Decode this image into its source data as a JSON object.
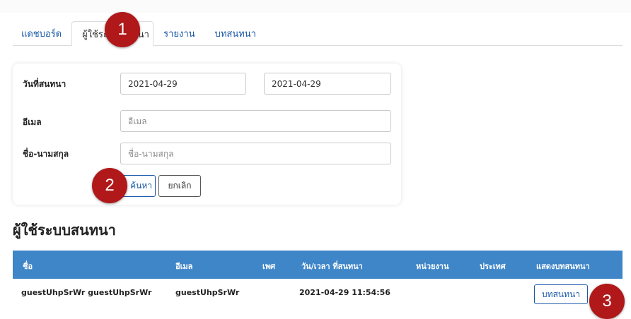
{
  "tabs": [
    {
      "label": "แดชบอร์ด"
    },
    {
      "label": "ผู้ใช้ระบบสนทนา"
    },
    {
      "label": "รายงาน"
    },
    {
      "label": "บทสนทนา"
    }
  ],
  "filter": {
    "date_label": "วันที่สนทนา",
    "date_from": "2021-04-29",
    "date_to": "2021-04-29",
    "email_label": "อีเมล",
    "email_placeholder": "อีเมล",
    "name_label": "ชื่อ-นามสกุล",
    "name_placeholder": "ชื่อ-นามสกุล",
    "search_label": "ค้นหา",
    "cancel_label": "ยกเลิก"
  },
  "section_title": "ผู้ใช้ระบบสนทนา",
  "table": {
    "headers": [
      "ชื่อ",
      "อีเมล",
      "เพศ",
      "วัน/เวลา ที่สนทนา",
      "หน่วยงาน",
      "ประเทศ",
      "แสดงบทสนทนา"
    ],
    "rows": [
      {
        "name": "guestUhpSrWr guestUhpSrWr",
        "email": "guestUhpSrWr",
        "gender": "",
        "datetime": "2021-04-29 11:54:56",
        "department": "",
        "country": "",
        "action": "บทสนทนา"
      }
    ]
  },
  "annotations": [
    "1",
    "2",
    "3"
  ],
  "colors": {
    "accent": "#1c5aa8",
    "table_header": "#3f86c8",
    "badge": "#b0181a"
  }
}
